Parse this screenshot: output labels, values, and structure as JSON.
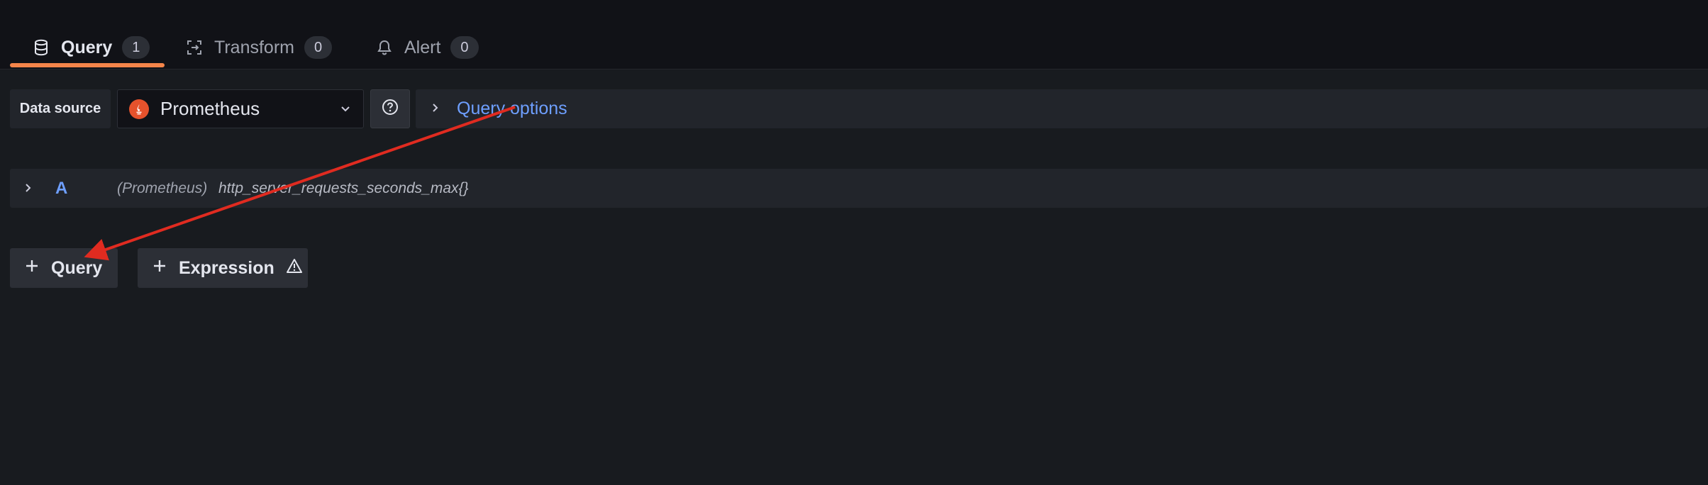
{
  "tabs": [
    {
      "label": "Query",
      "count": "1",
      "icon": "database-icon"
    },
    {
      "label": "Transform",
      "count": "0",
      "icon": "transform-icon"
    },
    {
      "label": "Alert",
      "count": "0",
      "icon": "bell-icon"
    }
  ],
  "datasource": {
    "label": "Data source",
    "selected": "Prometheus",
    "logo": "prometheus-logo-icon",
    "help_icon": "question-circle-icon"
  },
  "query_options": {
    "label": "Query options"
  },
  "queries": [
    {
      "ref_id": "A",
      "source": "(Prometheus)",
      "expression": "http_server_requests_seconds_max{}"
    }
  ],
  "buttons": {
    "add_query": "Query",
    "add_expression": "Expression"
  },
  "colors": {
    "background": "#181b1f",
    "accent_tab": "#f5854a",
    "link_blue": "#6e9fff",
    "annotation_arrow": "#e02b20"
  }
}
